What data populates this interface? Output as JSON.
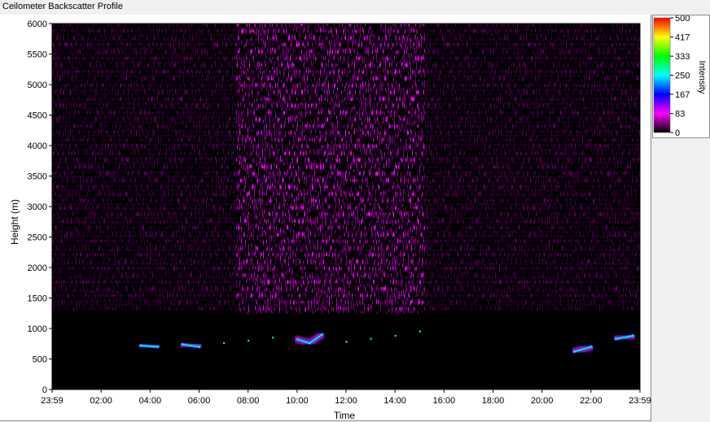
{
  "window": {
    "title": "Ceilometer Backscatter Profile"
  },
  "colors": {
    "background": "#000000",
    "low": "#8000a0",
    "mid": "#ff00ff",
    "high": "#ff3000"
  },
  "chart_data": {
    "type": "heatmap",
    "title": "Ceilometer Backscatter Profile",
    "xlabel": "Time",
    "ylabel": "Height (m)",
    "x_tick_labels": [
      "23:59",
      "02:00",
      "04:00",
      "06:00",
      "08:00",
      "10:00",
      "12:00",
      "14:00",
      "16:00",
      "18:00",
      "20:00",
      "22:00",
      "23:59"
    ],
    "x_range_hours": [
      -0.0167,
      23.9833
    ],
    "y_ticks": [
      0,
      500,
      1000,
      1500,
      2000,
      2500,
      3000,
      3500,
      4000,
      4500,
      5000,
      5500,
      6000
    ],
    "ylim": [
      0,
      6000
    ],
    "colorbar": {
      "label": "Intensity",
      "ticks": [
        0,
        83,
        167,
        250,
        333,
        417,
        500
      ],
      "range": [
        0,
        500
      ],
      "stops": [
        "#000000",
        "#ff00ff",
        "#0000ff",
        "#00ffff",
        "#00ff00",
        "#ffff00",
        "#ff0000"
      ]
    },
    "scatter_enhanced_period_hours": [
      7.5,
      15.2
    ],
    "cloud_layer": [
      {
        "time": 3.6,
        "height": 720
      },
      {
        "time": 4.3,
        "height": 700
      },
      {
        "time": 5.3,
        "height": 740
      },
      {
        "time": 6.0,
        "height": 700
      },
      {
        "time": 7.0,
        "height": 760
      },
      {
        "time": 8.0,
        "height": 800
      },
      {
        "time": 9.0,
        "height": 850
      },
      {
        "time": 10.0,
        "height": 820
      },
      {
        "time": 10.5,
        "height": 760
      },
      {
        "time": 11.0,
        "height": 900
      },
      {
        "time": 12.0,
        "height": 780
      },
      {
        "time": 13.0,
        "height": 830
      },
      {
        "time": 14.0,
        "height": 880
      },
      {
        "time": 15.0,
        "height": 950
      },
      {
        "time": 21.3,
        "height": 620
      },
      {
        "time": 22.0,
        "height": 700
      },
      {
        "time": 23.0,
        "height": 830
      },
      {
        "time": 23.7,
        "height": 880
      }
    ]
  }
}
